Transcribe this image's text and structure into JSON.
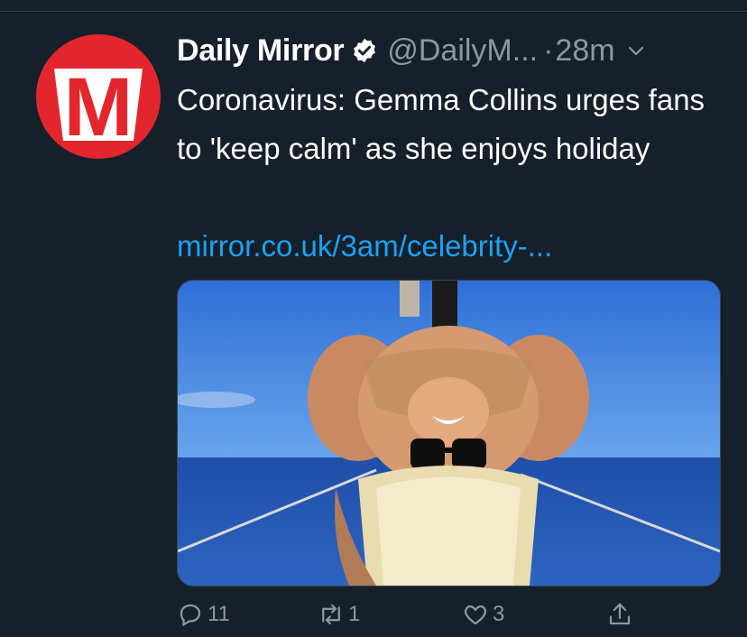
{
  "tweet": {
    "author_name": "Daily Mirror",
    "handle": "@DailyM...",
    "separator": "·",
    "time": "28m",
    "text": "Coronavirus: Gemma Collins urges fans to 'keep calm' as she enjoys holiday",
    "link_text": "mirror.co.uk/3am/celebrity-...",
    "avatar_letter": "M",
    "verified": true
  },
  "actions": {
    "reply_count": "11",
    "retweet_count": "1",
    "like_count": "3"
  },
  "colors": {
    "background": "#15202b",
    "secondary_text": "#8899a6",
    "link": "#1da1f2",
    "brand_red": "#e3262e"
  },
  "icons": [
    "verified-badge-icon",
    "chevron-down-icon",
    "reply-icon",
    "retweet-icon",
    "like-icon",
    "share-icon"
  ]
}
